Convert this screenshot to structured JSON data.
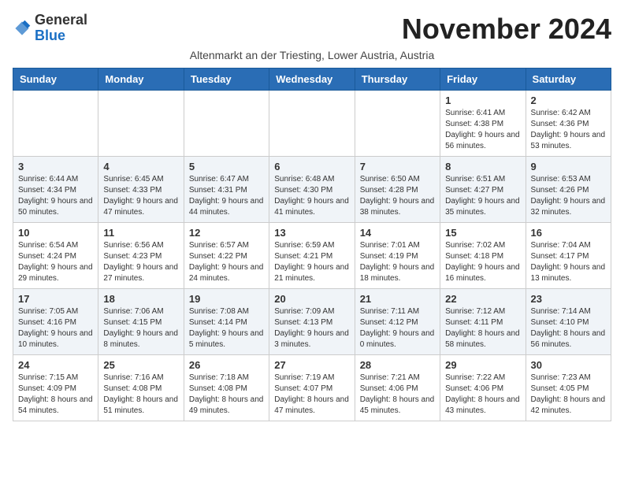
{
  "logo": {
    "general": "General",
    "blue": "Blue"
  },
  "title": "November 2024",
  "subtitle": "Altenmarkt an der Triesting, Lower Austria, Austria",
  "headers": [
    "Sunday",
    "Monday",
    "Tuesday",
    "Wednesday",
    "Thursday",
    "Friday",
    "Saturday"
  ],
  "weeks": [
    [
      {
        "day": "",
        "info": ""
      },
      {
        "day": "",
        "info": ""
      },
      {
        "day": "",
        "info": ""
      },
      {
        "day": "",
        "info": ""
      },
      {
        "day": "",
        "info": ""
      },
      {
        "day": "1",
        "info": "Sunrise: 6:41 AM\nSunset: 4:38 PM\nDaylight: 9 hours and 56 minutes."
      },
      {
        "day": "2",
        "info": "Sunrise: 6:42 AM\nSunset: 4:36 PM\nDaylight: 9 hours and 53 minutes."
      }
    ],
    [
      {
        "day": "3",
        "info": "Sunrise: 6:44 AM\nSunset: 4:34 PM\nDaylight: 9 hours and 50 minutes."
      },
      {
        "day": "4",
        "info": "Sunrise: 6:45 AM\nSunset: 4:33 PM\nDaylight: 9 hours and 47 minutes."
      },
      {
        "day": "5",
        "info": "Sunrise: 6:47 AM\nSunset: 4:31 PM\nDaylight: 9 hours and 44 minutes."
      },
      {
        "day": "6",
        "info": "Sunrise: 6:48 AM\nSunset: 4:30 PM\nDaylight: 9 hours and 41 minutes."
      },
      {
        "day": "7",
        "info": "Sunrise: 6:50 AM\nSunset: 4:28 PM\nDaylight: 9 hours and 38 minutes."
      },
      {
        "day": "8",
        "info": "Sunrise: 6:51 AM\nSunset: 4:27 PM\nDaylight: 9 hours and 35 minutes."
      },
      {
        "day": "9",
        "info": "Sunrise: 6:53 AM\nSunset: 4:26 PM\nDaylight: 9 hours and 32 minutes."
      }
    ],
    [
      {
        "day": "10",
        "info": "Sunrise: 6:54 AM\nSunset: 4:24 PM\nDaylight: 9 hours and 29 minutes."
      },
      {
        "day": "11",
        "info": "Sunrise: 6:56 AM\nSunset: 4:23 PM\nDaylight: 9 hours and 27 minutes."
      },
      {
        "day": "12",
        "info": "Sunrise: 6:57 AM\nSunset: 4:22 PM\nDaylight: 9 hours and 24 minutes."
      },
      {
        "day": "13",
        "info": "Sunrise: 6:59 AM\nSunset: 4:21 PM\nDaylight: 9 hours and 21 minutes."
      },
      {
        "day": "14",
        "info": "Sunrise: 7:01 AM\nSunset: 4:19 PM\nDaylight: 9 hours and 18 minutes."
      },
      {
        "day": "15",
        "info": "Sunrise: 7:02 AM\nSunset: 4:18 PM\nDaylight: 9 hours and 16 minutes."
      },
      {
        "day": "16",
        "info": "Sunrise: 7:04 AM\nSunset: 4:17 PM\nDaylight: 9 hours and 13 minutes."
      }
    ],
    [
      {
        "day": "17",
        "info": "Sunrise: 7:05 AM\nSunset: 4:16 PM\nDaylight: 9 hours and 10 minutes."
      },
      {
        "day": "18",
        "info": "Sunrise: 7:06 AM\nSunset: 4:15 PM\nDaylight: 9 hours and 8 minutes."
      },
      {
        "day": "19",
        "info": "Sunrise: 7:08 AM\nSunset: 4:14 PM\nDaylight: 9 hours and 5 minutes."
      },
      {
        "day": "20",
        "info": "Sunrise: 7:09 AM\nSunset: 4:13 PM\nDaylight: 9 hours and 3 minutes."
      },
      {
        "day": "21",
        "info": "Sunrise: 7:11 AM\nSunset: 4:12 PM\nDaylight: 9 hours and 0 minutes."
      },
      {
        "day": "22",
        "info": "Sunrise: 7:12 AM\nSunset: 4:11 PM\nDaylight: 8 hours and 58 minutes."
      },
      {
        "day": "23",
        "info": "Sunrise: 7:14 AM\nSunset: 4:10 PM\nDaylight: 8 hours and 56 minutes."
      }
    ],
    [
      {
        "day": "24",
        "info": "Sunrise: 7:15 AM\nSunset: 4:09 PM\nDaylight: 8 hours and 54 minutes."
      },
      {
        "day": "25",
        "info": "Sunrise: 7:16 AM\nSunset: 4:08 PM\nDaylight: 8 hours and 51 minutes."
      },
      {
        "day": "26",
        "info": "Sunrise: 7:18 AM\nSunset: 4:08 PM\nDaylight: 8 hours and 49 minutes."
      },
      {
        "day": "27",
        "info": "Sunrise: 7:19 AM\nSunset: 4:07 PM\nDaylight: 8 hours and 47 minutes."
      },
      {
        "day": "28",
        "info": "Sunrise: 7:21 AM\nSunset: 4:06 PM\nDaylight: 8 hours and 45 minutes."
      },
      {
        "day": "29",
        "info": "Sunrise: 7:22 AM\nSunset: 4:06 PM\nDaylight: 8 hours and 43 minutes."
      },
      {
        "day": "30",
        "info": "Sunrise: 7:23 AM\nSunset: 4:05 PM\nDaylight: 8 hours and 42 minutes."
      }
    ]
  ]
}
